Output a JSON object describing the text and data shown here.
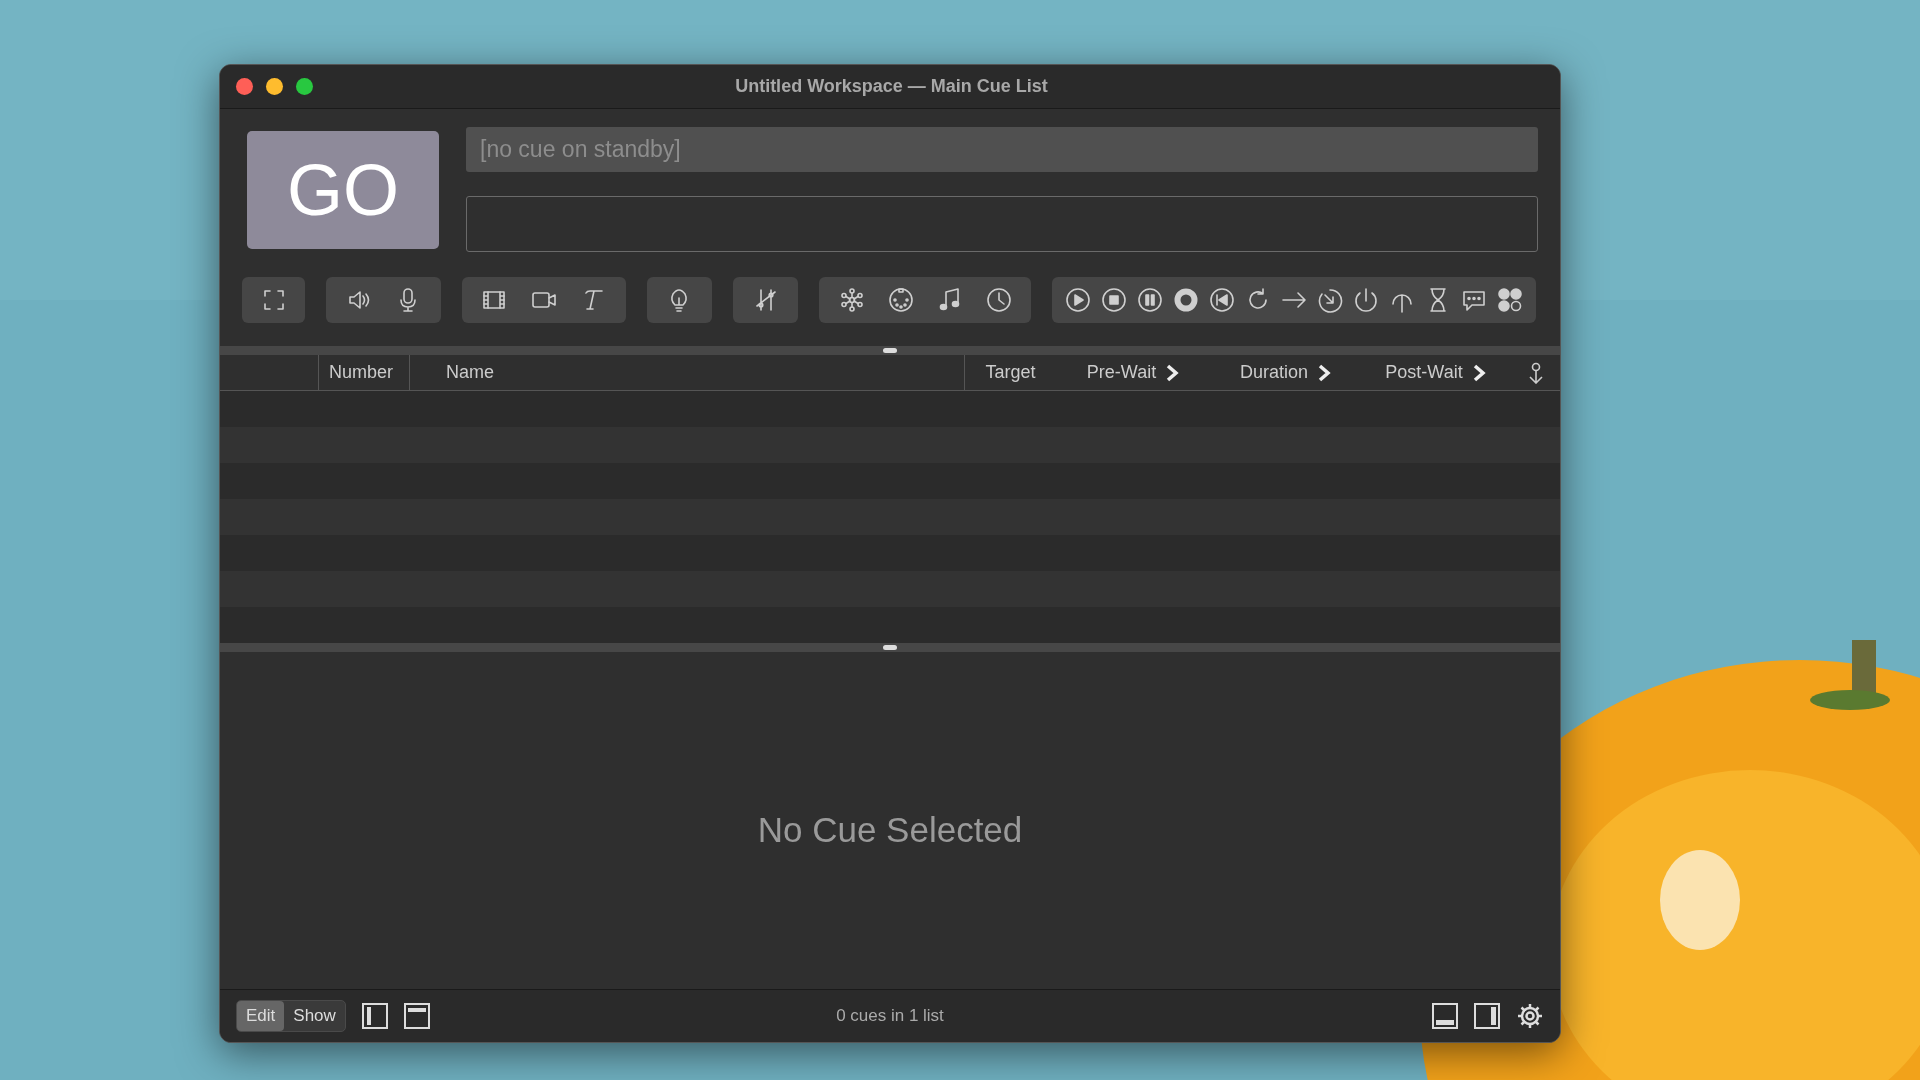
{
  "window": {
    "title": "Untitled Workspace — Main Cue List"
  },
  "go_button": {
    "label": "GO"
  },
  "standby": {
    "placeholder": "[no cue on standby]"
  },
  "columns": [
    {
      "label": "Number",
      "kind": "plain"
    },
    {
      "label": "Name",
      "kind": "plain"
    },
    {
      "label": "Target",
      "kind": "plain"
    },
    {
      "label": "Pre-Wait",
      "kind": "disclosure"
    },
    {
      "label": "Duration",
      "kind": "disclosure"
    },
    {
      "label": "Post-Wait",
      "kind": "disclosure"
    }
  ],
  "inspector": {
    "message": "No Cue Selected"
  },
  "status_bar": {
    "modes": [
      {
        "label": "Edit",
        "selected": true
      },
      {
        "label": "Show",
        "selected": false
      }
    ],
    "summary": "0 cues in 1 list"
  }
}
